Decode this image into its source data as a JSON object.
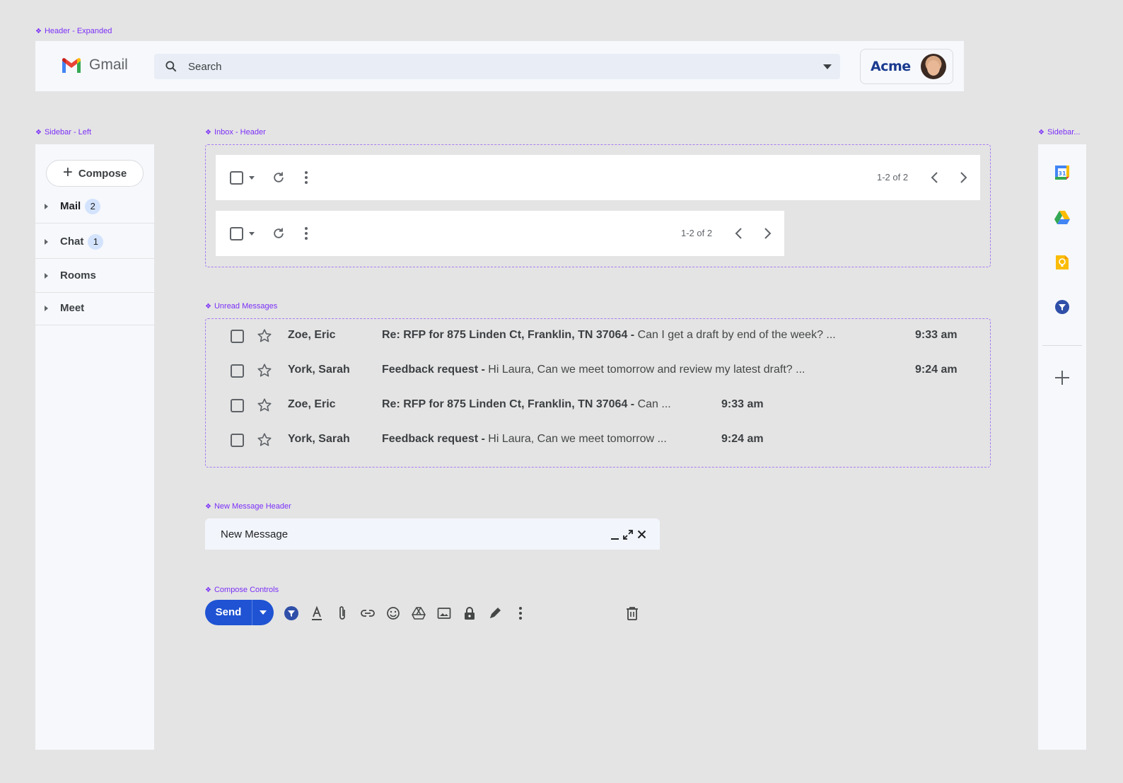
{
  "frames": {
    "header": "Header - Expanded",
    "sidebar_left": "Sidebar - Left",
    "inbox_header": "Inbox - Header",
    "sidebar_right": "Sidebar...",
    "unread": "Unread Messages",
    "new_message_header": "New Message Header",
    "compose_controls": "Compose Controls"
  },
  "header": {
    "app_name": "Gmail",
    "search_placeholder": "Search",
    "account_name": "Acme"
  },
  "sidebar": {
    "compose_label": "Compose",
    "items": [
      {
        "label": "Mail",
        "badge": "2"
      },
      {
        "label": "Chat",
        "badge": "1"
      },
      {
        "label": "Rooms"
      },
      {
        "label": "Meet"
      }
    ]
  },
  "inbox_toolbar": {
    "wide_count": "1-2 of 2",
    "narrow_count": "1-2 of 2"
  },
  "messages": [
    {
      "sender": "Zoe, Eric",
      "subject": "Re: RFP for 875 Linden Ct, Franklin, TN 37064 -",
      "preview": " Can I get a draft by end of the week? ...",
      "time": "9:33 am"
    },
    {
      "sender": "York, Sarah",
      "subject": "Feedback request -",
      "preview": " Hi Laura, Can we meet tomorrow and review my latest draft? ...",
      "time": "9:24 am"
    },
    {
      "sender": "Zoe, Eric",
      "subject": "Re: RFP for 875 Linden Ct, Franklin, TN 37064 -",
      "preview": " Can ...",
      "time": "9:33 am"
    },
    {
      "sender": "York, Sarah",
      "subject": "Feedback request -",
      "preview": " Hi Laura, Can we meet tomorrow ...",
      "time": "9:24 am"
    }
  ],
  "new_message": {
    "title": "New Message"
  },
  "compose_controls": {
    "send_label": "Send",
    "icons": [
      "filter-icon",
      "text-format-icon",
      "attach-icon",
      "link-icon",
      "emoji-icon",
      "drive-icon",
      "image-icon",
      "lock-icon",
      "pen-icon",
      "more-options-icon",
      "trash-icon"
    ]
  },
  "colors": {
    "accent": "#1f53d3",
    "frame_label": "#7b2ff7",
    "badge": "#d3e3fd"
  }
}
